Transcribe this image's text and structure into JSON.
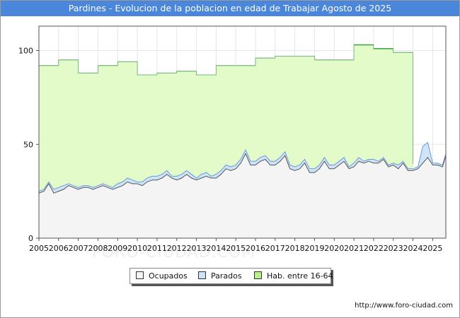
{
  "title": "Pardines - Evolucion de la poblacion en edad de Trabajar Agosto de 2025",
  "footer_url": "http://www.foro-ciudad.com",
  "watermark": "FORO-CIUDAD.COM",
  "chart_data": {
    "type": "area",
    "title": "Pardines - Evolucion de la poblacion en edad de Trabajar Agosto de 2025",
    "xlabel": "",
    "ylabel": "",
    "x_ticks": [
      "2005",
      "2006",
      "2007",
      "2008",
      "2009",
      "2010",
      "2011",
      "2012",
      "2013",
      "2014",
      "2015",
      "2016",
      "2017",
      "2018",
      "2019",
      "2020",
      "2021",
      "2022",
      "2023",
      "2024",
      "2025"
    ],
    "y_ticks": [
      0,
      50,
      100
    ],
    "xlim": [
      2005,
      2025.67
    ],
    "ylim": [
      0,
      113
    ],
    "grid": true,
    "legend_position": "bottom",
    "colors": {
      "hab": "#e2fbc9",
      "hab_line": "#7ab87e",
      "hab_line_peak": "#3aa33a",
      "parados": "#cfe4fa",
      "parados_line": "#6a9ad8",
      "ocupados": "#f4f4f4",
      "ocupados_line": "#555555"
    },
    "series": [
      {
        "name": "Hab. entre 16-64",
        "steps": [
          {
            "x0": 2005,
            "x1": 2006,
            "v": 92
          },
          {
            "x0": 2006,
            "x1": 2007,
            "v": 95
          },
          {
            "x0": 2007,
            "x1": 2008,
            "v": 88
          },
          {
            "x0": 2008,
            "x1": 2009,
            "v": 92
          },
          {
            "x0": 2009,
            "x1": 2010,
            "v": 94
          },
          {
            "x0": 2010,
            "x1": 2011,
            "v": 87
          },
          {
            "x0": 2011,
            "x1": 2012,
            "v": 88
          },
          {
            "x0": 2012,
            "x1": 2013,
            "v": 89
          },
          {
            "x0": 2013,
            "x1": 2014,
            "v": 87
          },
          {
            "x0": 2014,
            "x1": 2016,
            "v": 92
          },
          {
            "x0": 2016,
            "x1": 2017,
            "v": 96
          },
          {
            "x0": 2017,
            "x1": 2019,
            "v": 97
          },
          {
            "x0": 2019,
            "x1": 2021,
            "v": 95
          },
          {
            "x0": 2021,
            "x1": 2022,
            "v": 103
          },
          {
            "x0": 2022,
            "x1": 2023,
            "v": 101
          },
          {
            "x0": 2023,
            "x1": 2024,
            "v": 99
          }
        ]
      },
      {
        "name": "Parados",
        "x": [
          2005,
          2005.25,
          2005.5,
          2005.75,
          2006,
          2006.25,
          2006.5,
          2006.75,
          2007,
          2007.25,
          2007.5,
          2007.75,
          2008,
          2008.25,
          2008.5,
          2008.75,
          2009,
          2009.25,
          2009.5,
          2009.75,
          2010,
          2010.25,
          2010.5,
          2010.75,
          2011,
          2011.25,
          2011.5,
          2011.75,
          2012,
          2012.25,
          2012.5,
          2012.75,
          2013,
          2013.25,
          2013.5,
          2013.75,
          2014,
          2014.25,
          2014.5,
          2014.75,
          2015,
          2015.25,
          2015.5,
          2015.75,
          2016,
          2016.25,
          2016.5,
          2016.75,
          2017,
          2017.25,
          2017.5,
          2017.75,
          2018,
          2018.25,
          2018.5,
          2018.75,
          2019,
          2019.25,
          2019.5,
          2019.75,
          2020,
          2020.25,
          2020.5,
          2020.75,
          2021,
          2021.25,
          2021.5,
          2021.75,
          2022,
          2022.25,
          2022.5,
          2022.75,
          2023,
          2023.25,
          2023.5,
          2023.75,
          2024,
          2024.25,
          2024.5,
          2024.75,
          2025,
          2025.25,
          2025.5,
          2025.67
        ],
        "values": [
          25,
          26,
          30,
          26,
          27,
          28,
          29,
          28,
          27,
          28,
          28,
          27,
          28,
          29,
          28,
          27,
          29,
          30,
          32,
          31,
          30,
          30,
          32,
          33,
          33,
          34,
          36,
          33,
          33,
          34,
          36,
          34,
          32,
          34,
          35,
          33,
          34,
          36,
          39,
          38,
          39,
          42,
          47,
          41,
          41,
          43,
          44,
          41,
          41,
          43,
          46,
          39,
          38,
          39,
          42,
          37,
          37,
          39,
          43,
          39,
          39,
          41,
          43,
          38,
          40,
          43,
          41,
          42,
          42,
          41,
          43,
          39,
          40,
          39,
          41,
          37,
          37,
          38,
          49,
          51,
          40,
          40,
          39,
          45
        ]
      },
      {
        "name": "Ocupados",
        "x": [
          2005,
          2005.25,
          2005.5,
          2005.75,
          2006,
          2006.25,
          2006.5,
          2006.75,
          2007,
          2007.25,
          2007.5,
          2007.75,
          2008,
          2008.25,
          2008.5,
          2008.75,
          2009,
          2009.25,
          2009.5,
          2009.75,
          2010,
          2010.25,
          2010.5,
          2010.75,
          2011,
          2011.25,
          2011.5,
          2011.75,
          2012,
          2012.25,
          2012.5,
          2012.75,
          2013,
          2013.25,
          2013.5,
          2013.75,
          2014,
          2014.25,
          2014.5,
          2014.75,
          2015,
          2015.25,
          2015.5,
          2015.75,
          2016,
          2016.25,
          2016.5,
          2016.75,
          2017,
          2017.25,
          2017.5,
          2017.75,
          2018,
          2018.25,
          2018.5,
          2018.75,
          2019,
          2019.25,
          2019.5,
          2019.75,
          2020,
          2020.25,
          2020.5,
          2020.75,
          2021,
          2021.25,
          2021.5,
          2021.75,
          2022,
          2022.25,
          2022.5,
          2022.75,
          2023,
          2023.25,
          2023.5,
          2023.75,
          2024,
          2024.25,
          2024.5,
          2024.75,
          2025,
          2025.25,
          2025.5,
          2025.67
        ],
        "values": [
          24,
          25,
          29,
          24,
          25,
          26,
          28,
          27,
          26,
          27,
          27,
          26,
          27,
          28,
          27,
          26,
          27,
          28,
          30,
          29,
          29,
          28,
          30,
          31,
          31,
          32,
          34,
          32,
          31,
          32,
          34,
          32,
          31,
          32,
          33,
          32,
          32,
          34,
          37,
          36,
          37,
          40,
          45,
          39,
          39,
          41,
          42,
          39,
          39,
          41,
          44,
          37,
          36,
          37,
          40,
          35,
          35,
          37,
          41,
          37,
          37,
          39,
          41,
          37,
          38,
          41,
          40,
          41,
          40,
          40,
          42,
          38,
          39,
          37,
          40,
          36,
          36,
          37,
          40,
          43,
          39,
          39,
          38,
          44
        ]
      }
    ]
  },
  "legend": {
    "items": [
      {
        "label": "Ocupados"
      },
      {
        "label": "Parados"
      },
      {
        "label": "Hab. entre 16-64"
      }
    ]
  }
}
